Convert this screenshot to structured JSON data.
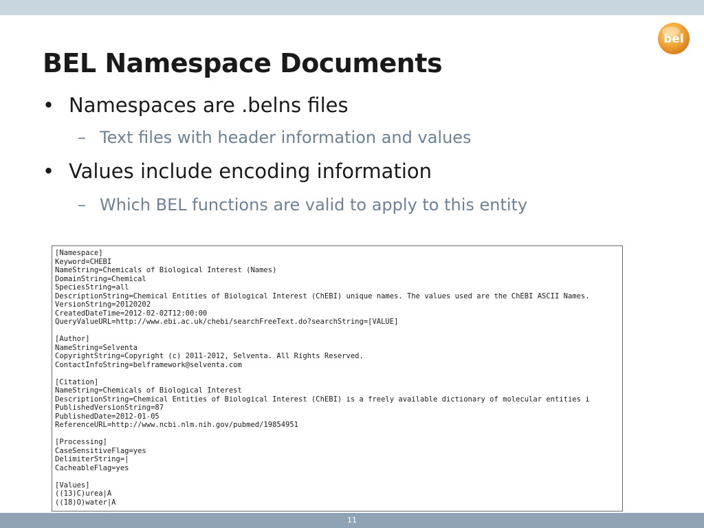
{
  "title": "BEL Namespace Documents",
  "bullets": [
    {
      "marker": "•",
      "text": "Namespaces are .belns files"
    },
    {
      "marker": "–",
      "text": "Text files with header information and values"
    },
    {
      "marker": "•",
      "text": "Values include encoding information"
    },
    {
      "marker": "–",
      "text": "Which BEL functions are valid to apply to this entity"
    }
  ],
  "file_lines": [
    "[Namespace]",
    "Keyword=CHEBI",
    "NameString=Chemicals of Biological Interest (Names)",
    "DomainString=Chemical",
    "SpeciesString=all",
    "DescriptionString=Chemical Entities of Biological Interest (ChEBI) unique names. The values used are the ChEBI ASCII Names.",
    "VersionString=20120202",
    "CreatedDateTime=2012-02-02T12:00:00",
    "QueryValueURL=http://www.ebi.ac.uk/chebi/searchFreeText.do?searchString=[VALUE]",
    "",
    "[Author]",
    "NameString=Selventa",
    "CopyrightString=Copyright (c) 2011-2012, Selventa. All Rights Reserved.",
    "ContactInfoString=belframework@selventa.com",
    "",
    "[Citation]",
    "NameString=Chemicals of Biological Interest",
    "DescriptionString=Chemical Entities of Biological Interest (ChEBI) is a freely available dictionary of molecular entities i",
    "PublishedVersionString=87",
    "PublishedDate=2012-01-05",
    "ReferenceURL=http://www.ncbi.nlm.nih.gov/pubmed/19854951",
    "",
    "[Processing]",
    "CaseSensitiveFlag=yes",
    "DelimiterString=|",
    "CacheableFlag=yes",
    "",
    "[Values]",
    "((13)C)urea|A",
    "((18)O)water|A"
  ],
  "logo_text": "bel",
  "page_number": "11",
  "colors": {
    "top_bar": "#c8d6e0",
    "bottom_bar": "#8fa3b5",
    "sub_bullet": "#6d8296",
    "logo_orange": "#f0a030"
  }
}
